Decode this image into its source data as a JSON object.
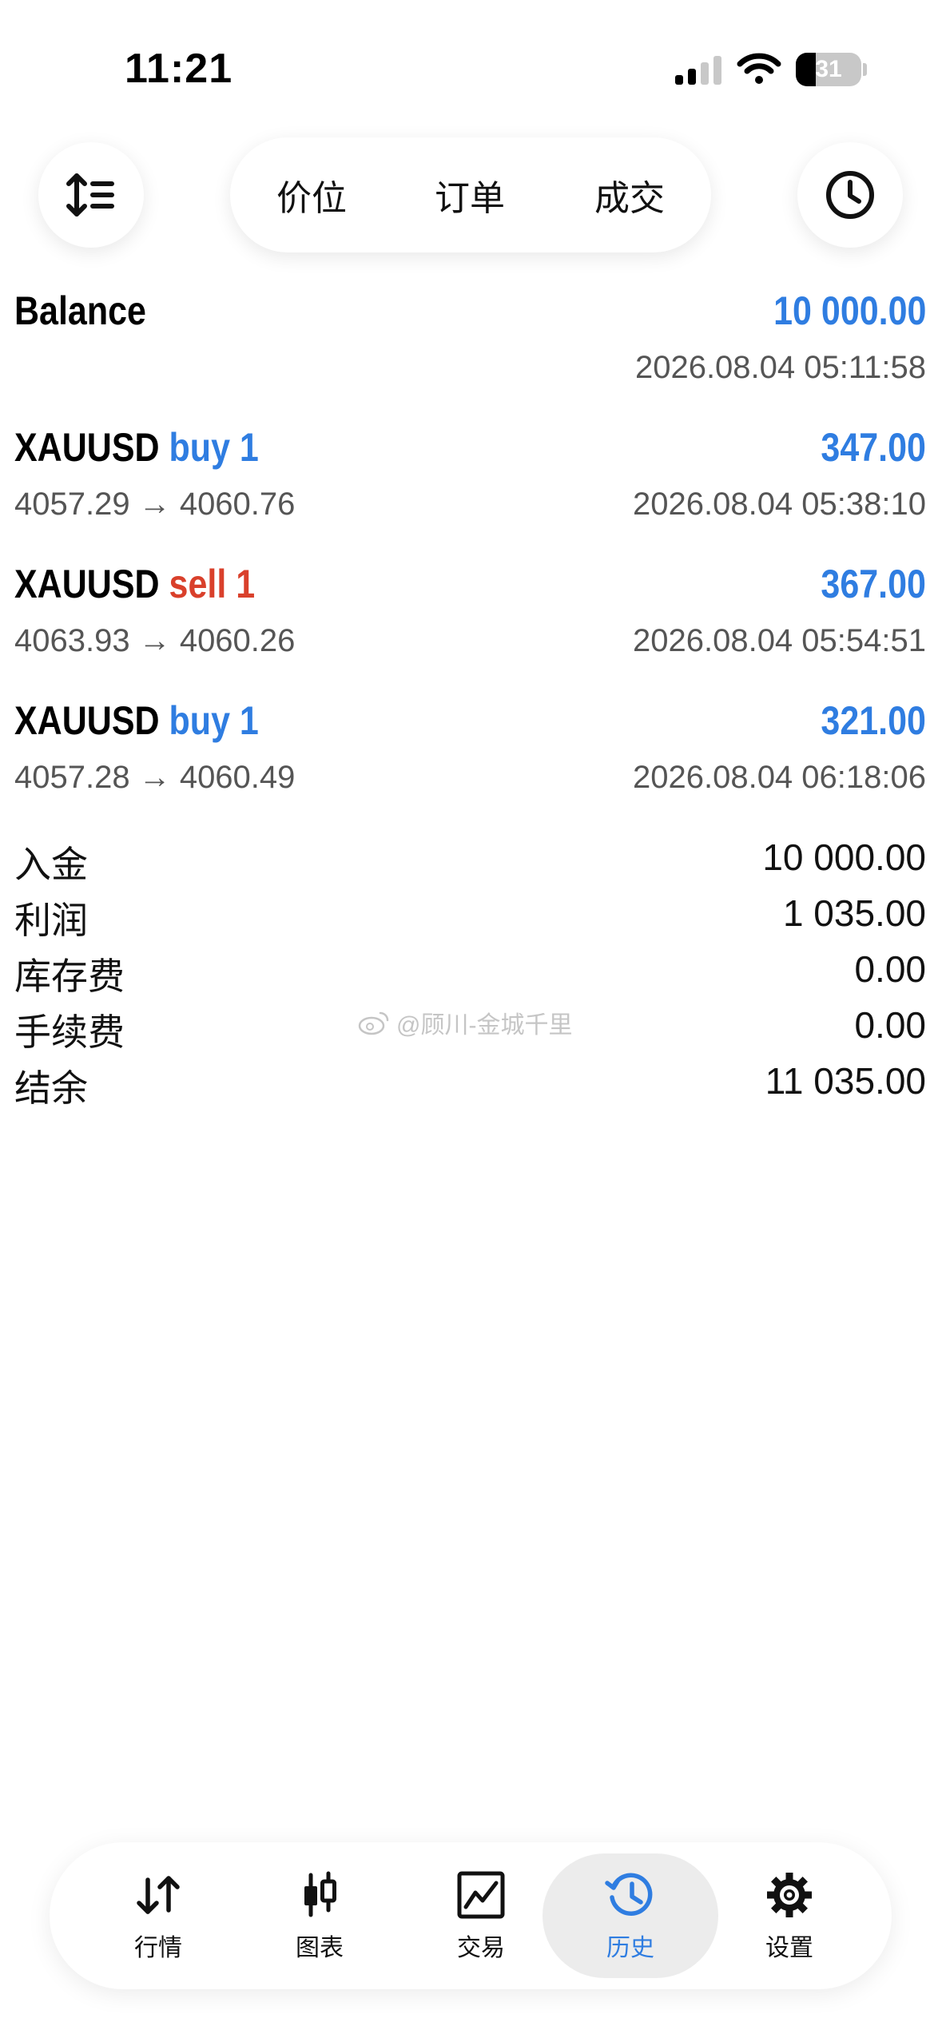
{
  "status_bar": {
    "time": "11:21",
    "battery": "31",
    "battery_level": 0.31
  },
  "segmented": {
    "tabs": [
      "价位",
      "订单",
      "成交"
    ],
    "active_index": 0
  },
  "balance": {
    "label": "Balance",
    "amount": "10 000.00",
    "time": "2026.08.04 05:11:58"
  },
  "deals": [
    {
      "symbol": "XAUUSD",
      "direction": "buy 1",
      "type": "buy",
      "profit": "347.00",
      "prices": "4057.29 → 4060.76",
      "time": "2026.08.04 05:38:10"
    },
    {
      "symbol": "XAUUSD",
      "direction": "sell 1",
      "type": "sell",
      "profit": "367.00",
      "prices": "4063.93 → 4060.26",
      "time": "2026.08.04 05:54:51"
    },
    {
      "symbol": "XAUUSD",
      "direction": "buy 1",
      "type": "buy",
      "profit": "321.00",
      "prices": "4057.28 → 4060.49",
      "time": "2026.08.04 06:18:06"
    }
  ],
  "summary": [
    {
      "label": "入金",
      "value": "10 000.00"
    },
    {
      "label": "利润",
      "value": "1 035.00"
    },
    {
      "label": "库存费",
      "value": "0.00"
    },
    {
      "label": "手续费",
      "value": "0.00"
    },
    {
      "label": "结余",
      "value": "11 035.00"
    }
  ],
  "watermark": "@顾川-金城千里",
  "tabbar": {
    "active_index": 3,
    "items": [
      {
        "label": "行情",
        "icon": "arrows-updown-icon"
      },
      {
        "label": "图表",
        "icon": "candlestick-icon"
      },
      {
        "label": "交易",
        "icon": "trade-chart-icon"
      },
      {
        "label": "历史",
        "icon": "history-icon"
      },
      {
        "label": "设置",
        "icon": "gear-icon"
      }
    ]
  },
  "colors": {
    "accent": "#2f7de1",
    "sell": "#d9402b"
  }
}
